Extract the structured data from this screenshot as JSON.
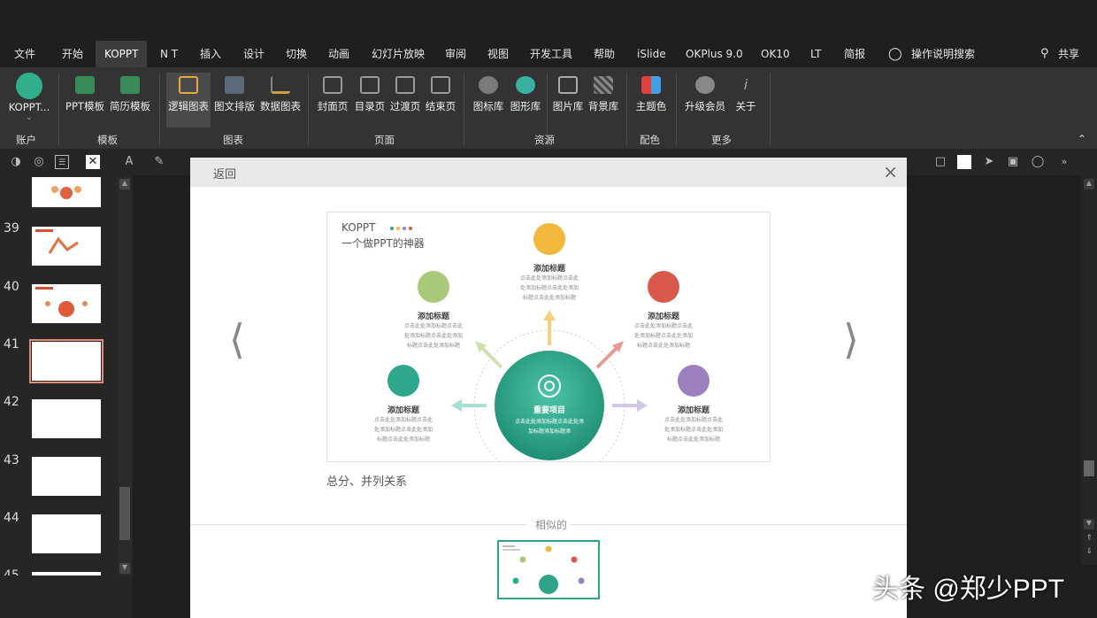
{
  "menu": {
    "items": [
      {
        "label": "文件"
      },
      {
        "label": "开始"
      },
      {
        "label": "KOPPT"
      },
      {
        "label": "N T"
      },
      {
        "label": "插入"
      },
      {
        "label": "设计"
      },
      {
        "label": "切换"
      },
      {
        "label": "动画"
      },
      {
        "label": "幻灯片放映"
      },
      {
        "label": "审阅"
      },
      {
        "label": "视图"
      },
      {
        "label": "开发工具"
      },
      {
        "label": "帮助"
      },
      {
        "label": "iSlide"
      },
      {
        "label": "OKPlus 9.0"
      },
      {
        "label": "OK10"
      },
      {
        "label": "LT"
      },
      {
        "label": "简报"
      },
      {
        "label": "操作说明搜索"
      }
    ],
    "share": "共享"
  },
  "ribbon": {
    "koppt": "KOPPT...",
    "account": "账户",
    "ppt_template": "PPT模板",
    "resume_template": "简历模板",
    "template_group": "模板",
    "logic_chart": "逻辑图表",
    "text_image": "图文排版",
    "data_chart": "数据图表",
    "chart_group": "图表",
    "cover": "封面页",
    "toc": "目录页",
    "transition": "过渡页",
    "end": "结束页",
    "page_group": "页面",
    "icon_lib": "图标库",
    "shape_lib": "图形库",
    "image_lib": "图片库",
    "bg_lib": "背景库",
    "resource_group": "资源",
    "theme_color": "主题色",
    "color_group": "配色",
    "upgrade": "升级会员",
    "about": "关于",
    "more_group": "更多"
  },
  "slides": {
    "numbers": [
      "39",
      "40",
      "41",
      "42",
      "43",
      "44",
      "45"
    ]
  },
  "dialog": {
    "back": "返回",
    "close": "×",
    "preview": {
      "brand": "KOPPT",
      "tagline": "一个做PPT的神器",
      "center_title": "重要项目",
      "center_text": "点击此处添加标题点击此处添加标题添加标题添",
      "node_title": "添加标题",
      "node_text1": "点击此处添加标题点击此",
      "node_text2": "处添加标题点击此处添加",
      "node_text3": "标题点击此处添加标题"
    },
    "caption": "总分、并列关系",
    "similar_label": "相似的"
  },
  "watermark": "头条 @郑少PPT",
  "colors": {
    "accent_teal": "#2fa38a",
    "yellow": "#f2b73c",
    "red": "#d9584a",
    "green_light": "#a9c97a",
    "purple": "#9b7fbf",
    "teal_node": "#2ea88c"
  }
}
